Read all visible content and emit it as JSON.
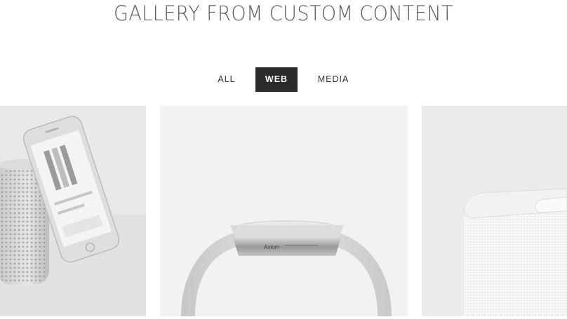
{
  "page": {
    "title": "GALLERY FROM CUSTOM CONTENT"
  },
  "filters": {
    "items": [
      {
        "label": "ALL",
        "active": false
      },
      {
        "label": "WEB",
        "active": true
      },
      {
        "label": "MEDIA",
        "active": false
      }
    ]
  },
  "gallery": {
    "items": [
      {
        "subject": "phone-and-speaker"
      },
      {
        "subject": "watch",
        "engraving": "Axiom"
      },
      {
        "subject": "white-device"
      }
    ]
  },
  "colors": {
    "active_filter_bg": "#2b2b2b",
    "title": "#555a63"
  }
}
